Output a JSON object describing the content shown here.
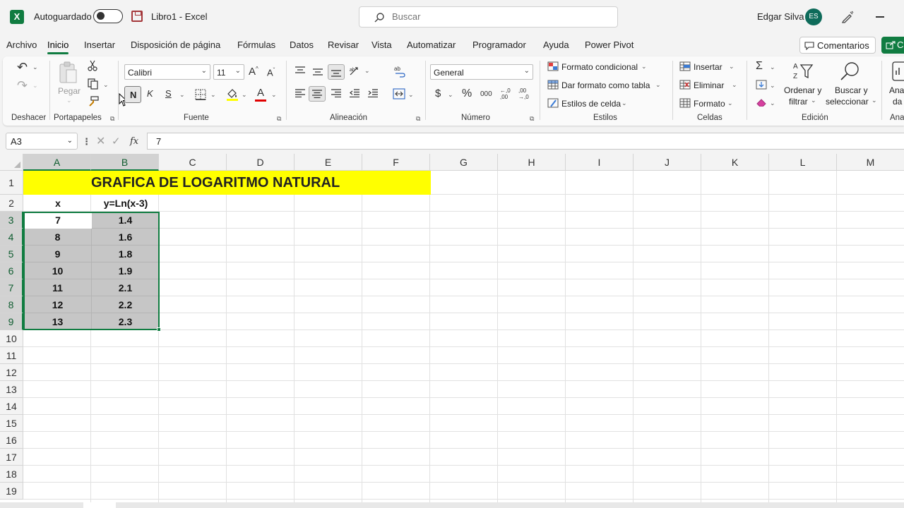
{
  "titlebar": {
    "logo_letter": "X",
    "autosave_label": "Autoguardado",
    "doc_title": "Libro1  -  Excel",
    "search_placeholder": "Buscar",
    "user_name": "Edgar Silva",
    "user_initials": "ES"
  },
  "menu": {
    "tabs": [
      "Archivo",
      "Inicio",
      "Insertar",
      "Disposición de página",
      "Fórmulas",
      "Datos",
      "Revisar",
      "Vista",
      "Automatizar",
      "Programador",
      "Ayuda",
      "Power Pivot"
    ],
    "active_tab": "Inicio",
    "comments_label": "Comentarios",
    "share_label": "C"
  },
  "ribbon": {
    "undo_group": "Deshacer",
    "clipboard": {
      "group": "Portapapeles",
      "paste_label": "Pegar"
    },
    "font": {
      "group": "Fuente",
      "font_name": "Calibri",
      "font_size": "11",
      "bold": "N",
      "italic": "K",
      "underline": "S",
      "grow": "A",
      "shrink": "A",
      "color_letter": "A"
    },
    "alignment": {
      "group": "Alineación"
    },
    "number": {
      "group": "Número",
      "format": "General",
      "currency": "$",
      "percent": "%",
      "thousands": "000",
      "inc_decimal": "←,0\n,00",
      "dec_decimal": ",00\n→,0"
    },
    "styles": {
      "group": "Estilos",
      "conditional": "Formato condicional",
      "as_table": "Dar formato como tabla",
      "cell_styles": "Estilos de celda"
    },
    "cells": {
      "group": "Celdas",
      "insert": "Insertar",
      "delete": "Eliminar",
      "format": "Formato"
    },
    "editing": {
      "group": "Edición",
      "sort_line1": "Ordenar y",
      "sort_line2": "filtrar",
      "find_line1": "Buscar y",
      "find_line2": "seleccionar"
    },
    "analyze": {
      "line1": "Ana",
      "line2": "da",
      "group": "Ana"
    }
  },
  "formulabar": {
    "name_box": "A3",
    "fx": "fx",
    "content": "7"
  },
  "sheet": {
    "columns": [
      "A",
      "B",
      "C",
      "D",
      "E",
      "F",
      "G",
      "H",
      "I",
      "J",
      "K",
      "L",
      "M"
    ],
    "rows": [
      "1",
      "2",
      "3",
      "4",
      "5",
      "6",
      "7",
      "8",
      "9",
      "10",
      "11",
      "12",
      "13",
      "14",
      "15",
      "16",
      "17",
      "18",
      "19"
    ],
    "title": "GRAFICA DE LOGARITMO NATURAL",
    "header_x": "x",
    "header_y": "y=Ln(x-3)",
    "data": [
      {
        "x": "7",
        "y": "1.4"
      },
      {
        "x": "8",
        "y": "1.6"
      },
      {
        "x": "9",
        "y": "1.8"
      },
      {
        "x": "10",
        "y": "1.9"
      },
      {
        "x": "11",
        "y": "2.1"
      },
      {
        "x": "12",
        "y": "2.2"
      },
      {
        "x": "13",
        "y": "2.3"
      }
    ],
    "title_fill": "#ffff00",
    "selection_fill": "#c6c6c6",
    "accent": "#107c41"
  }
}
